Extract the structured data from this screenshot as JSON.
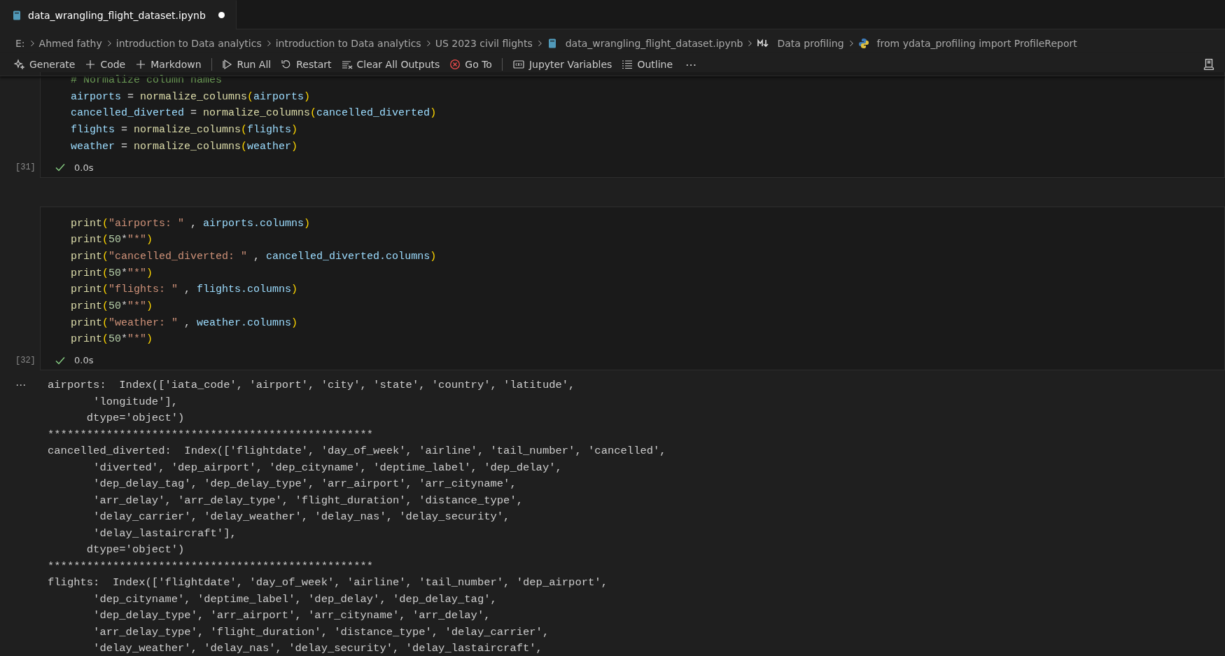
{
  "tab": {
    "title": "data_wrangling_flight_dataset.ipynb",
    "selected": true,
    "modified": true
  },
  "breadcrumbs": [
    {
      "kind": "plain",
      "label": "E:"
    },
    {
      "kind": "plain",
      "label": "Ahmed fathy"
    },
    {
      "kind": "plain",
      "label": "introduction to Data analytics"
    },
    {
      "kind": "plain",
      "label": "introduction to Data analytics"
    },
    {
      "kind": "plain",
      "label": "US 2023 civil flights"
    },
    {
      "kind": "notebook",
      "label": "data_wrangling_flight_dataset.ipynb"
    },
    {
      "kind": "markdown",
      "label": "Data profiling"
    },
    {
      "kind": "python",
      "label": "from ydata_profiling import ProfileReport"
    }
  ],
  "toolbar": [
    {
      "kind": "generate",
      "label": "Generate"
    },
    {
      "kind": "add",
      "label": "Code"
    },
    {
      "kind": "add",
      "label": "Markdown"
    },
    {
      "kind": "separator"
    },
    {
      "kind": "run",
      "label": "Run All"
    },
    {
      "kind": "restart",
      "label": "Restart"
    },
    {
      "kind": "clear",
      "label": "Clear All Outputs"
    },
    {
      "kind": "goto",
      "label": "Go To"
    },
    {
      "kind": "separator"
    },
    {
      "kind": "variables",
      "label": "Jupyter Variables"
    },
    {
      "kind": "outline",
      "label": "Outline"
    },
    {
      "kind": "more",
      "label": "⋯"
    }
  ],
  "cells": [
    {
      "execution_count": "[31]",
      "success": true,
      "duration": "0.0s",
      "lines": [
        [
          {
            "kind": "comment",
            "text": "# Normalize column names"
          }
        ],
        [
          {
            "kind": "var",
            "text": "airports"
          },
          {
            "kind": "plain",
            "text": " = "
          },
          {
            "kind": "func",
            "text": "normalize_columns"
          },
          {
            "kind": "paren",
            "text": "("
          },
          {
            "kind": "var",
            "text": "airports"
          },
          {
            "kind": "paren",
            "text": ")"
          }
        ],
        [
          {
            "kind": "var",
            "text": "cancelled_diverted"
          },
          {
            "kind": "plain",
            "text": " = "
          },
          {
            "kind": "func",
            "text": "normalize_columns"
          },
          {
            "kind": "paren",
            "text": "("
          },
          {
            "kind": "var",
            "text": "cancelled_diverted"
          },
          {
            "kind": "paren",
            "text": ")"
          }
        ],
        [
          {
            "kind": "var",
            "text": "flights"
          },
          {
            "kind": "plain",
            "text": " = "
          },
          {
            "kind": "func",
            "text": "normalize_columns"
          },
          {
            "kind": "paren",
            "text": "("
          },
          {
            "kind": "var",
            "text": "flights"
          },
          {
            "kind": "paren",
            "text": ")"
          }
        ],
        [
          {
            "kind": "var",
            "text": "weather"
          },
          {
            "kind": "plain",
            "text": " = "
          },
          {
            "kind": "func",
            "text": "normalize_columns"
          },
          {
            "kind": "paren",
            "text": "("
          },
          {
            "kind": "var",
            "text": "weather"
          },
          {
            "kind": "paren",
            "text": ")"
          }
        ]
      ]
    },
    {
      "execution_count": "[32]",
      "success": true,
      "duration": "0.0s",
      "lines": [
        [
          {
            "kind": "func",
            "text": "print"
          },
          {
            "kind": "paren",
            "text": "("
          },
          {
            "kind": "string",
            "text": "\"airports: \""
          },
          {
            "kind": "plain",
            "text": " , "
          },
          {
            "kind": "var",
            "text": "airports.columns"
          },
          {
            "kind": "paren",
            "text": ")"
          }
        ],
        [
          {
            "kind": "func",
            "text": "print"
          },
          {
            "kind": "paren",
            "text": "("
          },
          {
            "kind": "number",
            "text": "50"
          },
          {
            "kind": "plain",
            "text": "*"
          },
          {
            "kind": "string",
            "text": "\"*\""
          },
          {
            "kind": "paren",
            "text": ")"
          }
        ],
        [
          {
            "kind": "func",
            "text": "print"
          },
          {
            "kind": "paren",
            "text": "("
          },
          {
            "kind": "string",
            "text": "\"cancelled_diverted: \""
          },
          {
            "kind": "plain",
            "text": " , "
          },
          {
            "kind": "var",
            "text": "cancelled_diverted.columns"
          },
          {
            "kind": "paren",
            "text": ")"
          }
        ],
        [
          {
            "kind": "func",
            "text": "print"
          },
          {
            "kind": "paren",
            "text": "("
          },
          {
            "kind": "number",
            "text": "50"
          },
          {
            "kind": "plain",
            "text": "*"
          },
          {
            "kind": "string",
            "text": "\"*\""
          },
          {
            "kind": "paren",
            "text": ")"
          }
        ],
        [
          {
            "kind": "func",
            "text": "print"
          },
          {
            "kind": "paren",
            "text": "("
          },
          {
            "kind": "string",
            "text": "\"flights: \""
          },
          {
            "kind": "plain",
            "text": " , "
          },
          {
            "kind": "var",
            "text": "flights.columns"
          },
          {
            "kind": "paren",
            "text": ")"
          }
        ],
        [
          {
            "kind": "func",
            "text": "print"
          },
          {
            "kind": "paren",
            "text": "("
          },
          {
            "kind": "number",
            "text": "50"
          },
          {
            "kind": "plain",
            "text": "*"
          },
          {
            "kind": "string",
            "text": "\"*\""
          },
          {
            "kind": "paren",
            "text": ")"
          }
        ],
        [
          {
            "kind": "func",
            "text": "print"
          },
          {
            "kind": "paren",
            "text": "("
          },
          {
            "kind": "string",
            "text": "\"weather: \""
          },
          {
            "kind": "plain",
            "text": " , "
          },
          {
            "kind": "var",
            "text": "weather.columns"
          },
          {
            "kind": "paren",
            "text": ")"
          }
        ],
        [
          {
            "kind": "func",
            "text": "print"
          },
          {
            "kind": "paren",
            "text": "("
          },
          {
            "kind": "number",
            "text": "50"
          },
          {
            "kind": "plain",
            "text": "*"
          },
          {
            "kind": "string",
            "text": "\"*\""
          },
          {
            "kind": "paren",
            "text": ")"
          }
        ]
      ],
      "output": {
        "menu": "⋯",
        "lines": [
          "airports:  Index(['iata_code', 'airport', 'city', 'state', 'country', 'latitude',",
          "       'longitude'],",
          "      dtype='object')",
          "**************************************************",
          "cancelled_diverted:  Index(['flightdate', 'day_of_week', 'airline', 'tail_number', 'cancelled',",
          "       'diverted', 'dep_airport', 'dep_cityname', 'deptime_label', 'dep_delay',",
          "       'dep_delay_tag', 'dep_delay_type', 'arr_airport', 'arr_cityname',",
          "       'arr_delay', 'arr_delay_type', 'flight_duration', 'distance_type',",
          "       'delay_carrier', 'delay_weather', 'delay_nas', 'delay_security',",
          "       'delay_lastaircraft'],",
          "      dtype='object')",
          "**************************************************",
          "flights:  Index(['flightdate', 'day_of_week', 'airline', 'tail_number', 'dep_airport',",
          "       'dep_cityname', 'deptime_label', 'dep_delay', 'dep_delay_tag',",
          "       'dep_delay_type', 'arr_airport', 'arr_cityname', 'arr_delay',",
          "       'arr_delay_type', 'flight_duration', 'distance_type', 'delay_carrier',",
          "       'delay_weather', 'delay_nas', 'delay_security', 'delay_lastaircraft',"
        ]
      }
    }
  ]
}
